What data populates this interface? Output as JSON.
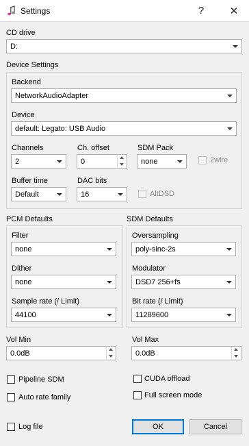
{
  "window": {
    "title": "Settings",
    "help": "?",
    "close": "✕"
  },
  "cd_drive": {
    "label": "CD drive",
    "value": "D:"
  },
  "device_settings": {
    "title": "Device Settings",
    "backend": {
      "label": "Backend",
      "value": "NetworkAudioAdapter"
    },
    "device": {
      "label": "Device",
      "value": "default: Legato: USB Audio"
    },
    "channels": {
      "label": "Channels",
      "value": "2"
    },
    "ch_offset": {
      "label": "Ch. offset",
      "value": "0"
    },
    "sdm_pack": {
      "label": "SDM Pack",
      "value": "none"
    },
    "two_wire": {
      "label": "2wire"
    },
    "buffer_time": {
      "label": "Buffer time",
      "value": "Default"
    },
    "dac_bits": {
      "label": "DAC bits",
      "value": "16"
    },
    "altdsd": {
      "label": "AltDSD"
    }
  },
  "pcm_defaults": {
    "title": "PCM Defaults",
    "filter": {
      "label": "Filter",
      "value": "none"
    },
    "dither": {
      "label": "Dither",
      "value": "none"
    },
    "sample_rate": {
      "label": "Sample rate (/ Limit)",
      "value": "44100"
    }
  },
  "sdm_defaults": {
    "title": "SDM Defaults",
    "oversampling": {
      "label": "Oversampling",
      "value": "poly-sinc-2s"
    },
    "modulator": {
      "label": "Modulator",
      "value": "DSD7 256+fs"
    },
    "bit_rate": {
      "label": "Bit rate (/ Limit)",
      "value": "11289600"
    }
  },
  "vol_min": {
    "label": "Vol Min",
    "value": "0.0dB"
  },
  "vol_max": {
    "label": "Vol Max",
    "value": "0.0dB"
  },
  "options": {
    "pipeline_sdm": "Pipeline SDM",
    "cuda_offload": "CUDA offload",
    "auto_rate_family": "Auto rate family",
    "full_screen_mode": "Full screen mode",
    "log_file": "Log file"
  },
  "buttons": {
    "ok": "OK",
    "cancel": "Cancel"
  }
}
